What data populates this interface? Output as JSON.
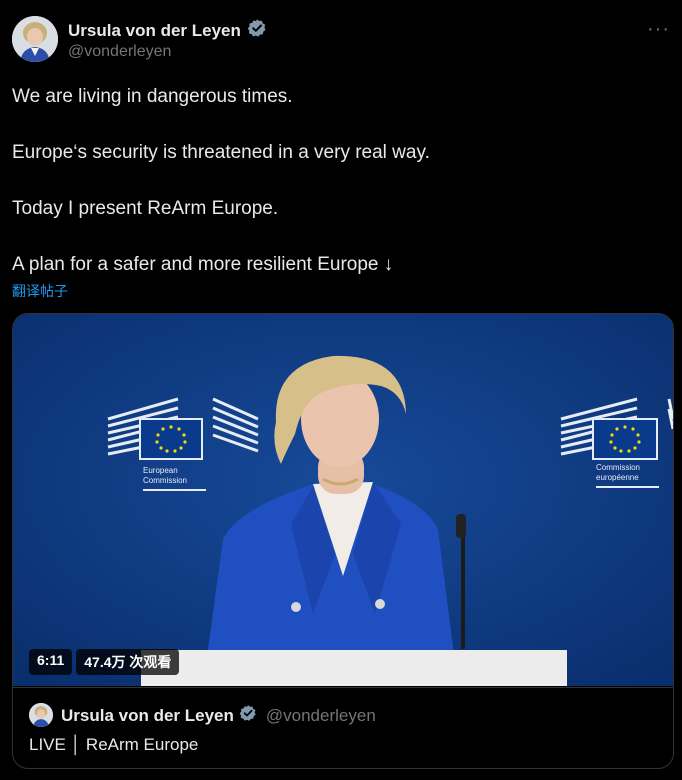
{
  "author": {
    "display_name": "Ursula von der Leyen",
    "handle": "@vonderleyen",
    "verified": true
  },
  "tweet": {
    "paragraphs": [
      "We are living in dangerous times.",
      "Europe‘s security is threatened in a very real way.",
      "Today I present ReArm Europe.",
      "A plan for a safer and more resilient Europe ↓"
    ],
    "translate_label": "翻译帖子"
  },
  "video": {
    "duration": "6:11",
    "views": "47.4万 次观看",
    "logo_left_lines": [
      "European",
      "Commission"
    ],
    "logo_right_lines": [
      "Commission",
      "européenne"
    ]
  },
  "quoted": {
    "display_name": "Ursula von der Leyen",
    "handle": "@vonderleyen",
    "text": "LIVE │ ReArm Europe"
  },
  "colors": {
    "background": "#000000",
    "text": "#e7e9ea",
    "muted": "#71767b",
    "link": "#1d9bf0",
    "verified": "#829aab",
    "video_bg": "#0d3a84"
  },
  "icons": {
    "more": "more-horizontal-icon",
    "verified": "verified-badge-icon"
  }
}
